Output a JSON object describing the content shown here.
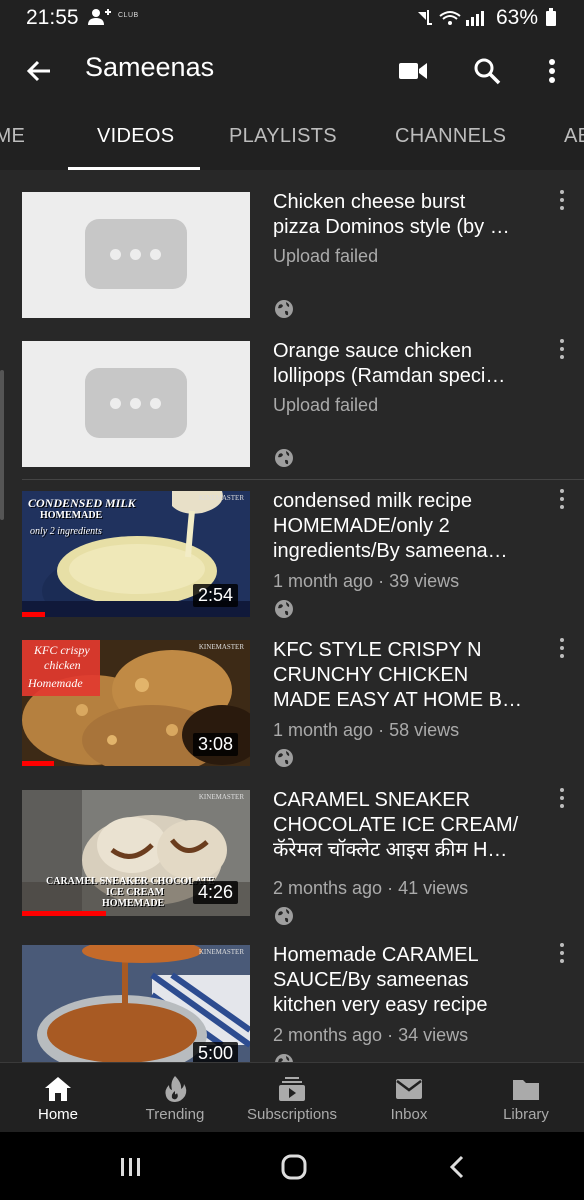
{
  "status": {
    "time": "21:55",
    "badge": "CLUB",
    "battery": "63%"
  },
  "appbar": {
    "title": "Sameenas"
  },
  "tabs": [
    {
      "label": "HOME"
    },
    {
      "label": "VIDEOS"
    },
    {
      "label": "PLAYLISTS"
    },
    {
      "label": "CHANNELS"
    },
    {
      "label": "ABOUT"
    }
  ],
  "videos": [
    {
      "title_line1": "Chicken cheese burst",
      "title_line2": "pizza Dominos style (by …",
      "status": "Upload failed"
    },
    {
      "title_line1": "Orange sauce chicken",
      "title_line2": "lollipops (Ramdan speci…",
      "status": "Upload failed"
    },
    {
      "title_line1": "condensed milk  recipe",
      "title_line2": "HOMEMADE/only 2",
      "title_line3": "ingredients/By sameena…",
      "meta": "1 month ago · 39 views",
      "duration": "2:54",
      "overlay": [
        "CONDENSED MILK",
        "HOMEMADE",
        "only 2 ingredients"
      ],
      "watermark": "KINEMASTER",
      "progress": 0.1
    },
    {
      "title_line1": "KFC STYLE CRISPY N",
      "title_line2": "CRUNCHY CHICKEN",
      "title_line3": "MADE EASY AT HOME B…",
      "meta": "1 month ago · 58 views",
      "duration": "3:08",
      "overlay": [
        "KFC crispy",
        "chicken",
        "Homemade"
      ],
      "watermark": "KINEMASTER",
      "progress": 0.14
    },
    {
      "title_line1": "CARAMEL SNEAKER",
      "title_line2": "CHOCOLATE ICE CREAM/",
      "title_line3": "कॅरेमल चॉक्लेट आइस क्रीम H…",
      "meta": "2 months ago · 41 views",
      "duration": "4:26",
      "overlay": [
        "CARAMEL SNEAKER CHOCOLATE",
        "ICE CREAM",
        "HOMEMADE"
      ],
      "watermark": "KINEMASTER",
      "progress": 0.37
    },
    {
      "title_line1": "Homemade CARAMEL",
      "title_line2": "SAUCE/By sameenas",
      "title_line3": "kitchen very easy recipe",
      "meta": "2 months ago · 34 views",
      "duration": "5:00",
      "watermark": "KINEMASTER"
    }
  ],
  "bottom_nav": [
    {
      "label": "Home",
      "icon": "home-icon"
    },
    {
      "label": "Trending",
      "icon": "flame-icon"
    },
    {
      "label": "Subscriptions",
      "icon": "subscriptions-icon"
    },
    {
      "label": "Inbox",
      "icon": "mail-icon"
    },
    {
      "label": "Library",
      "icon": "folder-icon"
    }
  ]
}
